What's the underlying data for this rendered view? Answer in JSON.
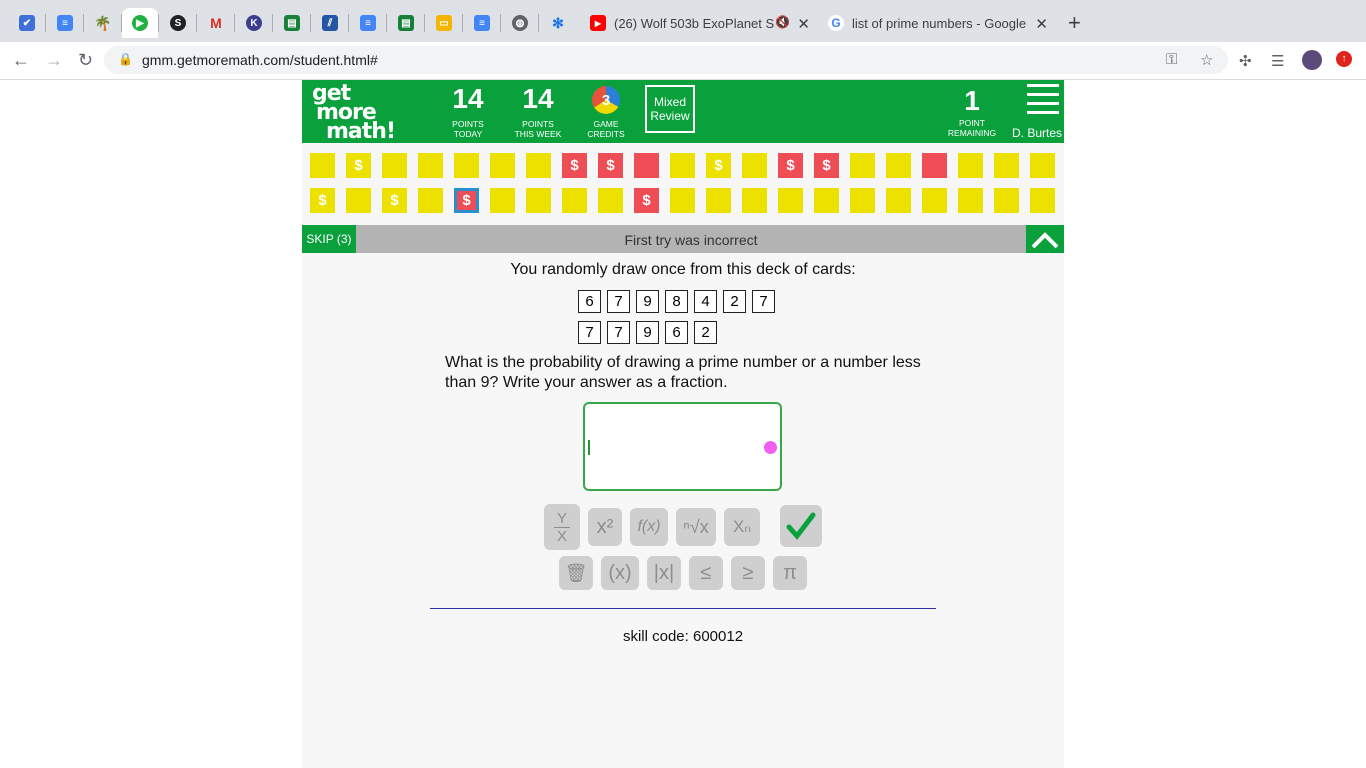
{
  "browser": {
    "pinned_tabs": [
      {
        "icon": "shield-check-icon",
        "color": "#3f6fd8",
        "glyph": "✔"
      },
      {
        "icon": "docs-icon",
        "color": "#4285f4",
        "glyph": "≡"
      },
      {
        "icon": "palm-tree-icon",
        "color": "#1e8e3e",
        "glyph": "🌴"
      },
      {
        "icon": "play-icon",
        "color": "#1fb141",
        "glyph": "▶"
      },
      {
        "icon": "s-circle-icon",
        "color": "#202124",
        "glyph": "S"
      },
      {
        "icon": "gmail-icon",
        "color": "#d93025",
        "glyph": "M"
      },
      {
        "icon": "k-circle-icon",
        "color": "#3c3f8f",
        "glyph": "K"
      },
      {
        "icon": "classroom-icon",
        "color": "#188038",
        "glyph": "▤"
      },
      {
        "icon": "stripes-icon",
        "color": "#2456a6",
        "glyph": "⫽"
      },
      {
        "icon": "docs-icon",
        "color": "#4285f4",
        "glyph": "≡"
      },
      {
        "icon": "classroom-icon",
        "color": "#188038",
        "glyph": "▤"
      },
      {
        "icon": "slides-icon",
        "color": "#f4b400",
        "glyph": "▭"
      },
      {
        "icon": "docs-icon",
        "color": "#4285f4",
        "glyph": "≡"
      },
      {
        "icon": "globe-icon",
        "color": "#5f6368",
        "glyph": "◍"
      },
      {
        "icon": "snowflake-icon",
        "color": "#1a73e8",
        "glyph": "✻"
      }
    ],
    "tabs": [
      {
        "title": "(26) Wolf 503b ExoPlanet S",
        "icon": "youtube-icon",
        "muted_icon": "speaker-muted-icon"
      },
      {
        "title": "list of prime numbers - Google",
        "icon": "google-icon"
      }
    ],
    "url": "gmm.getmoremath.com/student.html#",
    "accent_active_tab": "#ffffff"
  },
  "header": {
    "logo_lines": [
      "get",
      "more",
      "math!"
    ],
    "points_today": {
      "value": "14",
      "label_1": "POINTS",
      "label_2": "TODAY"
    },
    "points_week": {
      "value": "14",
      "label_1": "POINTS",
      "label_2": "THIS WEEK"
    },
    "game_credits": {
      "value": "3",
      "label_1": "GAME",
      "label_2": "CREDITS"
    },
    "mixed_review": {
      "line_1": "Mixed",
      "line_2": "Review"
    },
    "remaining": {
      "value": "1",
      "label_1": "POINT",
      "label_2": "REMAINING"
    },
    "user": "D. Burtes",
    "brand_color": "#0aa13d"
  },
  "progress": {
    "row1": [
      "y",
      "y$",
      "y",
      "y",
      "y",
      "y",
      "y",
      "r$",
      "r$",
      "r",
      "y",
      "y$",
      "y",
      "r$",
      "r$",
      "y",
      "y",
      "r",
      "y",
      "y",
      "y"
    ],
    "row2": [
      "y$",
      "y",
      "y$",
      "y",
      "r$cur",
      "y",
      "y",
      "y",
      "y",
      "r$",
      "y",
      "y",
      "y",
      "y",
      "y",
      "y",
      "y",
      "y",
      "y",
      "y",
      "y"
    ],
    "dollar": "$"
  },
  "question_bar": {
    "skip_label": "SKIP (3)",
    "status": "First try was incorrect"
  },
  "question": {
    "prompt": "You randomly draw once from this deck of cards:",
    "cards_row1": [
      "6",
      "7",
      "9",
      "8",
      "4",
      "2",
      "7"
    ],
    "cards_row2": [
      "7",
      "7",
      "9",
      "6",
      "2"
    ],
    "line_1": "What is the probability of drawing a prime number or a number less",
    "line_2": "than 9? Write your answer as a fraction.",
    "answer_value": ""
  },
  "keypad": {
    "fraction_top": "Y",
    "fraction_bottom": "X",
    "power": "x²",
    "function": "f(x)",
    "root": "ⁿ√x",
    "subscript": "Xₙ",
    "trash": "🗑",
    "parens": "(x)",
    "abs": "|x|",
    "le": "≤",
    "ge": "≥",
    "pi": "π"
  },
  "footer": {
    "skill_code": "skill code: 600012"
  }
}
